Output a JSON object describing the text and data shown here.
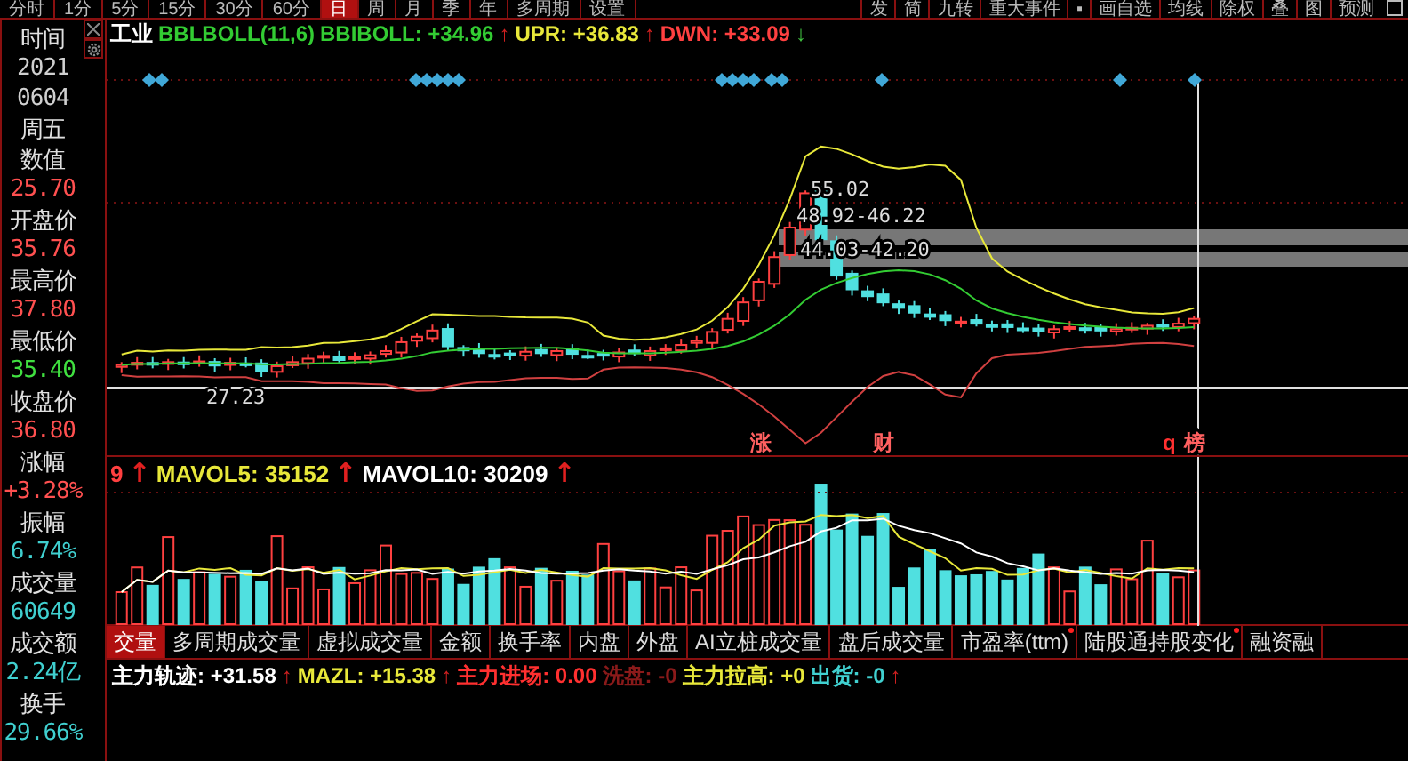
{
  "top_tabs": [
    {
      "label": "分时",
      "selected": false
    },
    {
      "label": "1分",
      "selected": false
    },
    {
      "label": "5分",
      "selected": false
    },
    {
      "label": "15分",
      "selected": false
    },
    {
      "label": "30分",
      "selected": false
    },
    {
      "label": "60分",
      "selected": false
    },
    {
      "label": "日",
      "selected": true
    },
    {
      "label": "周",
      "selected": false
    },
    {
      "label": "月",
      "selected": false
    },
    {
      "label": "季",
      "selected": false
    },
    {
      "label": "年",
      "selected": false
    },
    {
      "label": "多周期",
      "selected": false
    },
    {
      "label": "设置",
      "selected": false
    }
  ],
  "top_tools": [
    "发",
    "简",
    "九转",
    "重大事件",
    "▪",
    "画自选",
    "均线",
    "除权",
    "叠",
    "图",
    "预测"
  ],
  "info_panel": [
    {
      "text": "时间",
      "kind": "label"
    },
    {
      "text": "2021",
      "kind": "plain"
    },
    {
      "text": "0604",
      "kind": "plain"
    },
    {
      "text": "周五",
      "kind": "label"
    },
    {
      "text": "数值",
      "kind": "label"
    },
    {
      "text": "25.70",
      "kind": "up"
    },
    {
      "text": "开盘价",
      "kind": "label"
    },
    {
      "text": "35.76",
      "kind": "up"
    },
    {
      "text": "最高价",
      "kind": "label"
    },
    {
      "text": "37.80",
      "kind": "up"
    },
    {
      "text": "最低价",
      "kind": "label"
    },
    {
      "text": "35.40",
      "kind": "down"
    },
    {
      "text": "收盘价",
      "kind": "label"
    },
    {
      "text": "36.80",
      "kind": "up"
    },
    {
      "text": "涨幅",
      "kind": "label"
    },
    {
      "text": "+3.28%",
      "kind": "up"
    },
    {
      "text": "振幅",
      "kind": "label"
    },
    {
      "text": "6.74%",
      "kind": "info"
    },
    {
      "text": "成交量",
      "kind": "label"
    },
    {
      "text": "60649",
      "kind": "info"
    },
    {
      "text": "成交额",
      "kind": "label"
    },
    {
      "text": "2.24亿",
      "kind": "info"
    },
    {
      "text": "换手",
      "kind": "label"
    },
    {
      "text": "29.66%",
      "kind": "info"
    }
  ],
  "main_chart": {
    "legend": [
      {
        "text": "工业",
        "color": "#ffffff"
      },
      {
        "text": "BBLBOLL(11,6)",
        "color": "#33cc33"
      },
      {
        "text": "BBIBOLL: +34.96",
        "color": "#33cc33"
      },
      {
        "text": "↑",
        "color": "#d02020"
      },
      {
        "text": "UPR: +36.83",
        "color": "#e8e83a"
      },
      {
        "text": "↑",
        "color": "#d02020"
      },
      {
        "text": "DWN: +33.09",
        "color": "#ff4040"
      },
      {
        "text": "↓",
        "color": "#40c040"
      }
    ],
    "price_labels": [
      "55.02",
      "48.92-46.22",
      "44.03-42.20",
      "27.23"
    ],
    "markers": [
      "涨",
      "财",
      "q",
      "榜"
    ]
  },
  "volume_chart": {
    "legend": [
      {
        "text": "9",
        "color": "#ff4040",
        "kind": "text"
      },
      {
        "text": "↑",
        "color": "#e02020",
        "kind": "arrow"
      },
      {
        "text": "MAVOL5: 35152",
        "color": "#e8e83a",
        "kind": "text"
      },
      {
        "text": "↑",
        "color": "#e02020",
        "kind": "arrow"
      },
      {
        "text": "MAVOL10: 30209",
        "color": "#ffffff",
        "kind": "text"
      },
      {
        "text": "↑",
        "color": "#e02020",
        "kind": "arrow"
      }
    ]
  },
  "indicator_tabs": [
    {
      "label": "交量",
      "selected": true,
      "dot": false
    },
    {
      "label": "多周期成交量",
      "selected": false,
      "dot": false
    },
    {
      "label": "虚拟成交量",
      "selected": false,
      "dot": false
    },
    {
      "label": "金额",
      "selected": false,
      "dot": false
    },
    {
      "label": "换手率",
      "selected": false,
      "dot": false
    },
    {
      "label": "内盘",
      "selected": false,
      "dot": false
    },
    {
      "label": "外盘",
      "selected": false,
      "dot": false
    },
    {
      "label": "AI立桩成交量",
      "selected": false,
      "dot": false
    },
    {
      "label": "盘后成交量",
      "selected": false,
      "dot": false
    },
    {
      "label": "市盈率(ttm)",
      "selected": false,
      "dot": true
    },
    {
      "label": "陆股通持股变化",
      "selected": false,
      "dot": true
    },
    {
      "label": "融资融",
      "selected": false,
      "dot": false
    }
  ],
  "indicator_legend": [
    {
      "text": "主力轨迹: +31.58",
      "color": "#ffffff"
    },
    {
      "text": "↑",
      "color": "#d02020"
    },
    {
      "text": "MAZL: +15.38",
      "color": "#e8e83a"
    },
    {
      "text": "↑",
      "color": "#d02020"
    },
    {
      "text": "主力进场: 0.00",
      "color": "#ff3030"
    },
    {
      "text": "洗盘: -0",
      "color": "#8a1a1a"
    },
    {
      "text": "主力拉高: +0",
      "color": "#e8e83a"
    },
    {
      "text": "出货: -0",
      "color": "#40d0d0"
    },
    {
      "text": "↑",
      "color": "#d02020"
    }
  ]
}
